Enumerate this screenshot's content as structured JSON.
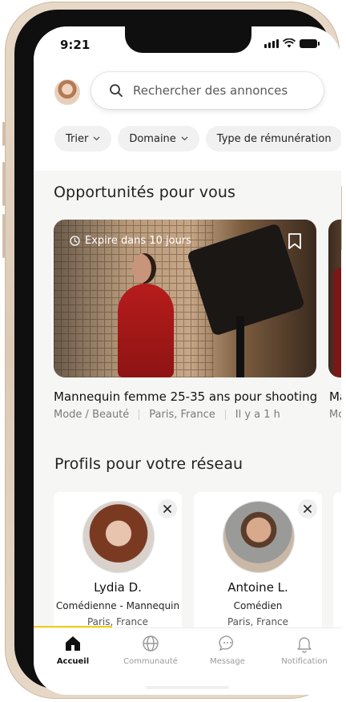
{
  "status_bar": {
    "time": "9:21"
  },
  "search": {
    "placeholder": "Rechercher des annonces"
  },
  "filters": [
    {
      "label": "Trier"
    },
    {
      "label": "Domaine"
    },
    {
      "label": "Type de rémunération"
    }
  ],
  "opportunities": {
    "title": "Opportunités pour vous",
    "cards": [
      {
        "expires": "Expire dans 10 jours",
        "title": "Mannequin femme 25-35 ans pour shooting",
        "category": "Mode / Beauté",
        "location": "Paris, France",
        "posted": "Il y a 1 h"
      },
      {
        "title": "Ma",
        "category": "Mo"
      }
    ]
  },
  "profiles": {
    "title": "Profils pour votre réseau",
    "cards": [
      {
        "name": "Lydia D.",
        "role": "Comédienne - Mannequin",
        "location": "Paris, France"
      },
      {
        "name": "Antoine L.",
        "role": "Comédien",
        "location": "Paris, France"
      }
    ]
  },
  "tabbar": {
    "items": [
      {
        "label": "Accueil",
        "icon": "home-icon",
        "active": true
      },
      {
        "label": "Communauté",
        "icon": "globe-icon"
      },
      {
        "label": "Message",
        "icon": "chat-bubble-icon"
      },
      {
        "label": "Notification",
        "icon": "bell-icon"
      }
    ]
  },
  "colors": {
    "accent": "#f2cf12",
    "background": "#f6f6f5",
    "text": "#111111"
  }
}
